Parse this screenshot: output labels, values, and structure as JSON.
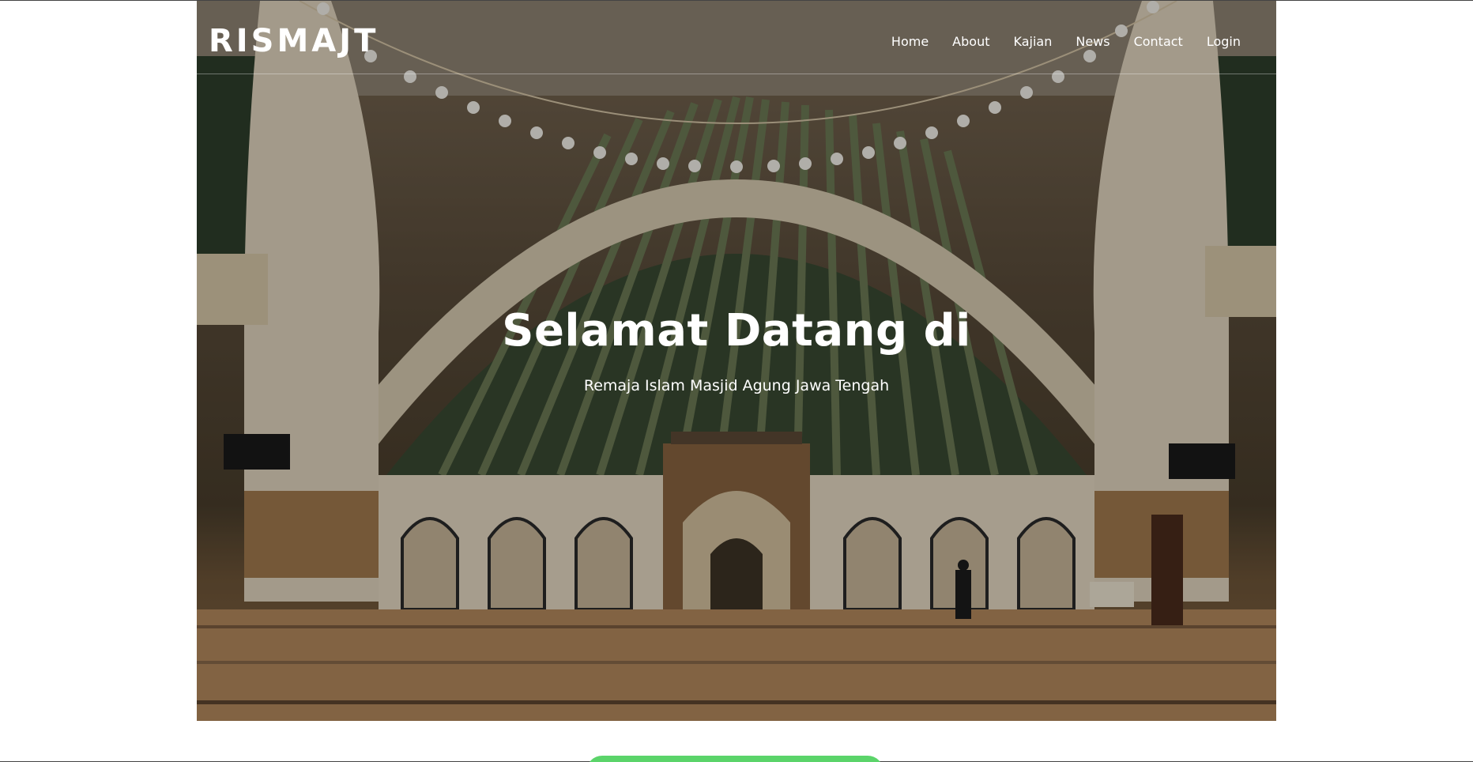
{
  "navbar": {
    "brand": "RISMAJT",
    "links": [
      "Home",
      "About",
      "Kajian",
      "News",
      "Contact",
      "Login"
    ]
  },
  "hero": {
    "title": "Selamat Datang di",
    "subtitle": "Remaja Islam Masjid Agung Jawa Tengah",
    "background_image": "mosque-interior-photo"
  },
  "colors": {
    "accent_green": "#5bd46a",
    "text_on_hero": "#ffffff"
  }
}
